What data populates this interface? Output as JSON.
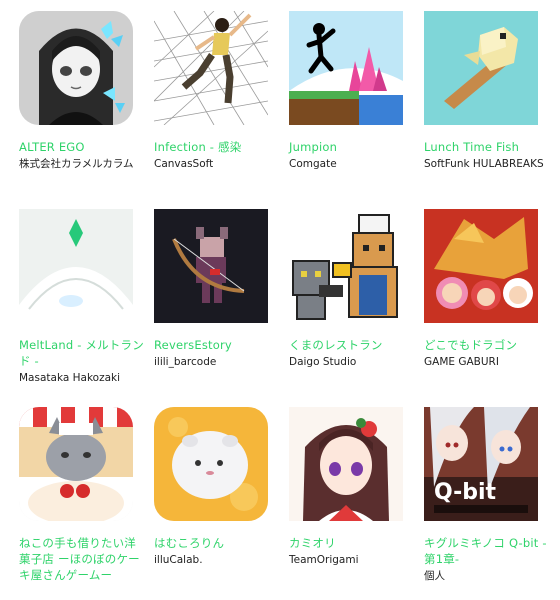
{
  "apps": [
    {
      "title": "ALTER EGO",
      "developer": "株式会社カラメルカラム",
      "icon": "alter-ego-icon"
    },
    {
      "title": "Infection - 感染",
      "developer": "CanvasSoft",
      "icon": "infection-icon"
    },
    {
      "title": "Jumpion",
      "developer": "Comgate",
      "icon": "jumpion-icon"
    },
    {
      "title": "Lunch Time Fish",
      "developer": "SoftFunk HULABREAKS",
      "icon": "lunch-time-fish-icon"
    },
    {
      "title": "MeltLand - メルトランド -",
      "developer": "Masataka Hakozaki",
      "icon": "meltland-icon"
    },
    {
      "title": "ReversEstory",
      "developer": "ilili_barcode",
      "icon": "reversestory-icon"
    },
    {
      "title": "くまのレストラン",
      "developer": "Daigo Studio",
      "icon": "kuma-restaurant-icon"
    },
    {
      "title": "どこでもドラゴン",
      "developer": "GAME GABURI",
      "icon": "dokodemo-dragon-icon"
    },
    {
      "title": "ねこの手も借りたい洋菓子店 ーほのぼのケーキ屋さんゲームー",
      "developer": "",
      "icon": "neko-cake-shop-icon"
    },
    {
      "title": "はむころりん",
      "developer": "illuCalab.",
      "icon": "hamukororin-icon"
    },
    {
      "title": "カミオリ",
      "developer": "TeamOrigami",
      "icon": "kamiori-icon"
    },
    {
      "title": "キグルミキノコ Q-bit -第1章-",
      "developer": "個人",
      "icon": "qbit-icon"
    }
  ],
  "qbit_logo_text": "Q-bit"
}
